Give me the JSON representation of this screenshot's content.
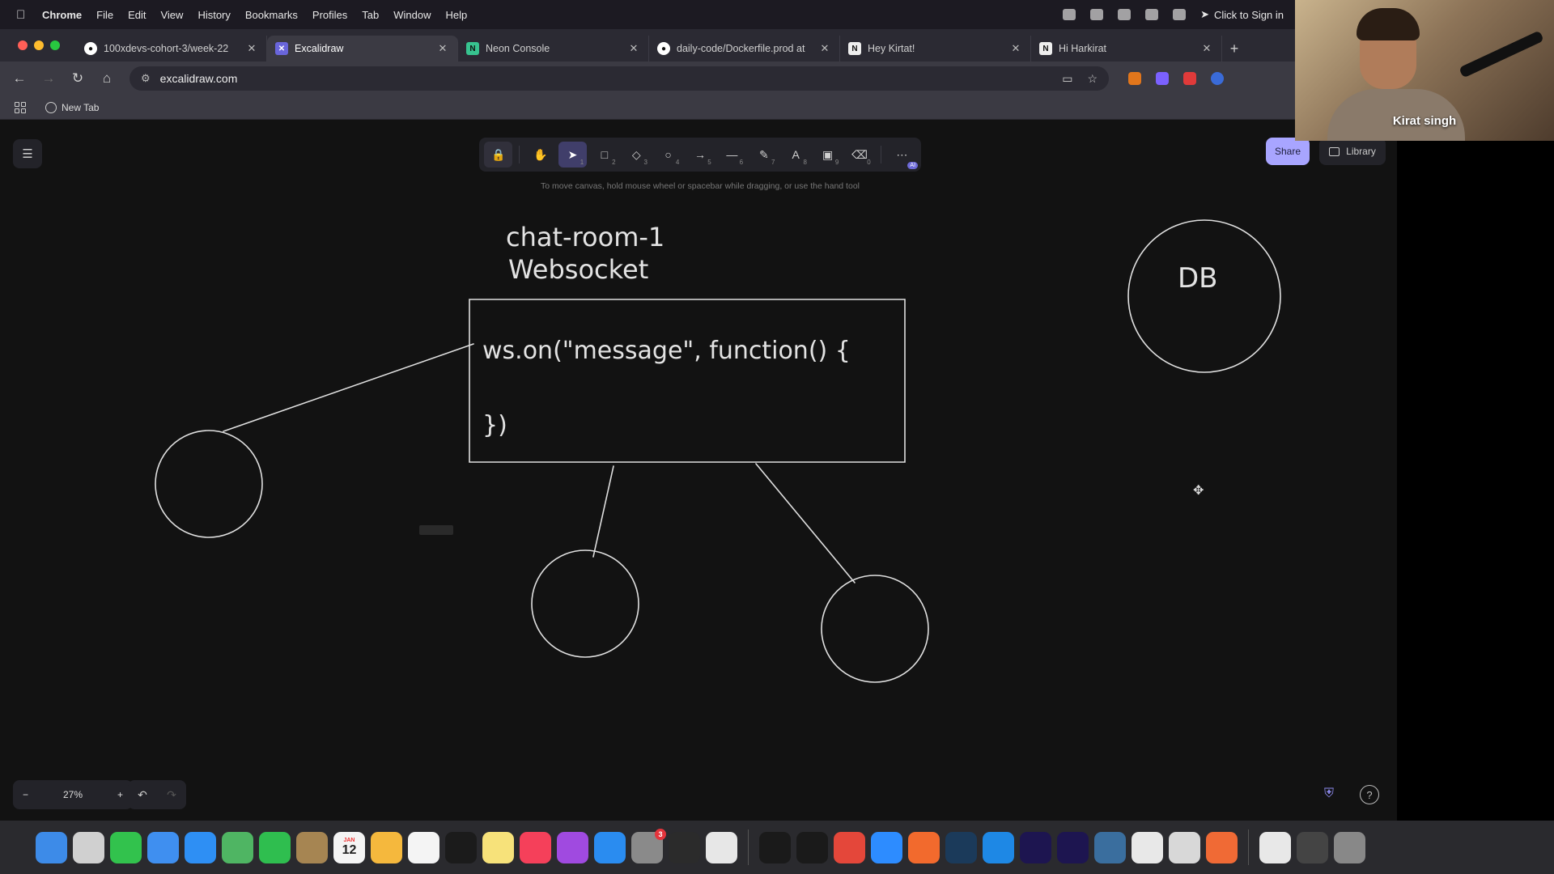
{
  "menubar": {
    "app_name": "Chrome",
    "menus": [
      "File",
      "Edit",
      "View",
      "History",
      "Bookmarks",
      "Profiles",
      "Tab",
      "Window",
      "Help"
    ],
    "sign_in": "Click to Sign in"
  },
  "tabs": [
    {
      "title": "100xdevs-cohort-3/week-22",
      "icon": "github-icon",
      "active": false
    },
    {
      "title": "Excalidraw",
      "icon": "excalidraw-icon",
      "active": true
    },
    {
      "title": "Neon Console",
      "icon": "neon-icon",
      "active": false
    },
    {
      "title": "daily-code/Dockerfile.prod at",
      "icon": "github-icon",
      "active": false
    },
    {
      "title": "Hey Kirtat!",
      "icon": "notion-icon",
      "active": false
    },
    {
      "title": "Hi Harkirat",
      "icon": "notion-icon",
      "active": false
    }
  ],
  "address_bar": {
    "url": "excalidraw.com"
  },
  "bookmarks": {
    "items": [
      {
        "label": "New Tab"
      }
    ]
  },
  "excalidraw": {
    "hint": "To move canvas, hold mouse wheel or spacebar while dragging, or use the hand tool",
    "share_label": "Share",
    "library_label": "Library",
    "zoom_level": "27%",
    "tools": [
      {
        "name": "lock",
        "glyph": "🔒",
        "key": ""
      },
      {
        "name": "hand",
        "glyph": "✋",
        "key": ""
      },
      {
        "name": "selection",
        "glyph": "➤",
        "key": "1"
      },
      {
        "name": "rectangle",
        "glyph": "□",
        "key": "2"
      },
      {
        "name": "diamond",
        "glyph": "◇",
        "key": "3"
      },
      {
        "name": "ellipse",
        "glyph": "○",
        "key": "4"
      },
      {
        "name": "arrow",
        "glyph": "→",
        "key": "5"
      },
      {
        "name": "line",
        "glyph": "—",
        "key": "6"
      },
      {
        "name": "draw",
        "glyph": "✎",
        "key": "7"
      },
      {
        "name": "text",
        "glyph": "A",
        "key": "8"
      },
      {
        "name": "image",
        "glyph": "▣",
        "key": "9"
      },
      {
        "name": "eraser",
        "glyph": "⌫",
        "key": "0"
      },
      {
        "name": "more-tools",
        "glyph": "⋯",
        "key": ""
      }
    ],
    "drawing": {
      "title_line1": "chat-room-1",
      "title_line2": "Websocket",
      "code_line1": "ws.on(\"message\", function() {",
      "code_line2": "})",
      "db_label": "DB"
    }
  },
  "webcam": {
    "name": "Kirat singh"
  },
  "dock": {
    "calendar_day": "12",
    "calendar_month": "JAN",
    "apps": [
      {
        "name": "finder",
        "color": "#3d8be8"
      },
      {
        "name": "launchpad",
        "color": "#d0d0d0"
      },
      {
        "name": "messages",
        "color": "#32c24d"
      },
      {
        "name": "mail",
        "color": "#3f8ff0"
      },
      {
        "name": "safari",
        "color": "#2e8ff4"
      },
      {
        "name": "maps",
        "color": "#4fb563"
      },
      {
        "name": "facetime",
        "color": "#2fbe4f"
      },
      {
        "name": "contacts",
        "color": "#a68552"
      },
      {
        "name": "calendar",
        "color": "#f4f4f4"
      },
      {
        "name": "photos",
        "color": "#f5b83d"
      },
      {
        "name": "reminders",
        "color": "#f4f4f4"
      },
      {
        "name": "apple-tv",
        "color": "#1b1b1b"
      },
      {
        "name": "notes",
        "color": "#f7e27a"
      },
      {
        "name": "music",
        "color": "#f5405a"
      },
      {
        "name": "podcasts",
        "color": "#a04ae0"
      },
      {
        "name": "app-store",
        "color": "#2a8cf0"
      },
      {
        "name": "system-settings",
        "color": "#8a8a8a"
      },
      {
        "name": "activity-monitor",
        "color": "#2b2b2b"
      },
      {
        "name": "preview",
        "color": "#e7e7e7"
      },
      {
        "name": "terminal",
        "color": "#1a1a1a"
      },
      {
        "name": "iterm",
        "color": "#1a1a1a"
      },
      {
        "name": "chrome",
        "color": "#e4473a"
      },
      {
        "name": "zoom",
        "color": "#2d8cff"
      },
      {
        "name": "brave",
        "color": "#f26a2d"
      },
      {
        "name": "steam",
        "color": "#1b3a5a"
      },
      {
        "name": "vscode",
        "color": "#1e88e5"
      },
      {
        "name": "premiere-pro",
        "color": "#1d1550"
      },
      {
        "name": "premiere-pro-2",
        "color": "#1d1550"
      },
      {
        "name": "quicktime",
        "color": "#3a6e9e"
      },
      {
        "name": "cursor",
        "color": "#e8e8e8"
      },
      {
        "name": "mirror",
        "color": "#d8d8d8"
      },
      {
        "name": "postman",
        "color": "#f06a35"
      },
      {
        "name": "documents",
        "color": "#e8e8e8"
      },
      {
        "name": "downloads",
        "color": "#444"
      },
      {
        "name": "trash",
        "color": "#888"
      }
    ],
    "settings_badge": "3"
  }
}
